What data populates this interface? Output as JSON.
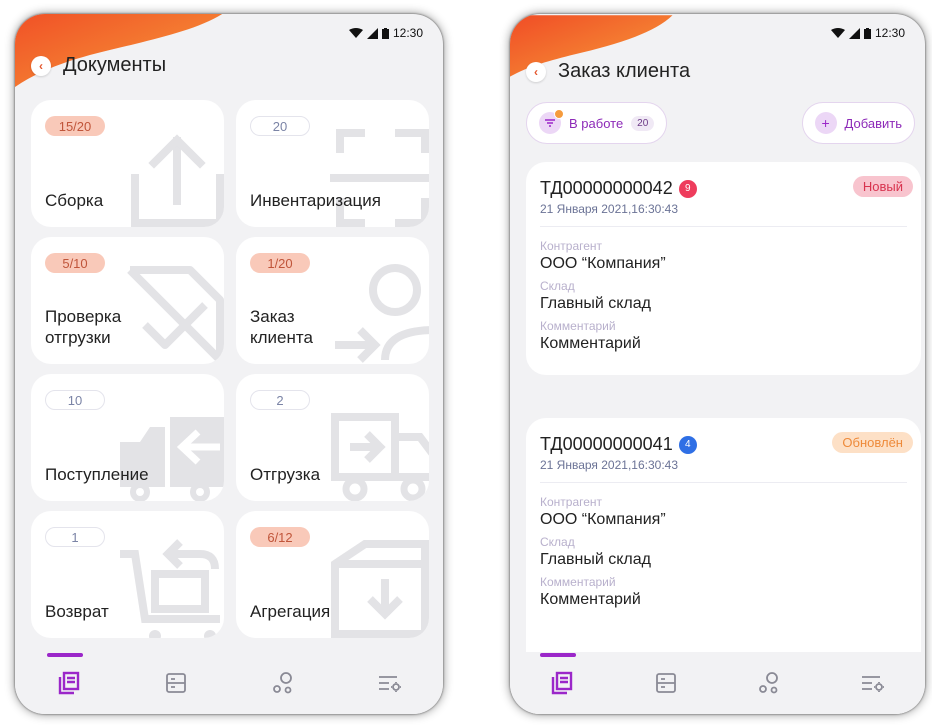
{
  "status_bar": {
    "time": "12:30"
  },
  "colors": {
    "accent": "#9b27c9",
    "orange": "#f26b2a",
    "new_badge_bg": "#f8c4ce",
    "updated_badge_bg": "#fde0c6"
  },
  "documents_screen": {
    "title": "Документы",
    "tiles": [
      {
        "label": "Сборка",
        "badge": "15/20",
        "icon": "upload-icon"
      },
      {
        "label": "Инвентаризация",
        "badge": "20",
        "icon": "scan-frame-icon"
      },
      {
        "label": "Проверка\nотгрузки",
        "badge": "5/10",
        "icon": "document-check-icon"
      },
      {
        "label": "Заказ\nклиента",
        "badge": "1/20",
        "icon": "user-arrow-icon"
      },
      {
        "label": "Поступление",
        "badge": "10",
        "icon": "truck-incoming-icon"
      },
      {
        "label": "Отгрузка",
        "badge": "2",
        "icon": "truck-outgoing-icon"
      },
      {
        "label": "Возврат",
        "badge": "1",
        "icon": "cart-return-icon"
      },
      {
        "label": "Агрегация",
        "badge": "6/12",
        "icon": "box-download-icon"
      }
    ]
  },
  "orders_screen": {
    "title": "Заказ клиента",
    "filter": {
      "label": "В работе",
      "count": "20"
    },
    "add_label": "Добавить",
    "orders": [
      {
        "number": "ТД00000000042",
        "count": "9",
        "status": "Новый",
        "date": "21 Января 2021,16:30:43",
        "fields": [
          {
            "label": "Контрагент",
            "value": "ООО “Компания”"
          },
          {
            "label": "Склад",
            "value": "Главный склад"
          },
          {
            "label": "Комментарий",
            "value": "Комментарий"
          }
        ]
      },
      {
        "number": "ТД00000000041",
        "count": "4",
        "status": "Обновлён",
        "date": "21 Января 2021,16:30:43",
        "fields": [
          {
            "label": "Контрагент",
            "value": "ООО “Компания”"
          },
          {
            "label": "Склад",
            "value": "Главный склад"
          },
          {
            "label": "Комментарий",
            "value": "Комментарий"
          }
        ]
      }
    ]
  },
  "bottom_nav": [
    "documents-icon",
    "list-icon",
    "circles-icon",
    "settings-list-icon"
  ]
}
